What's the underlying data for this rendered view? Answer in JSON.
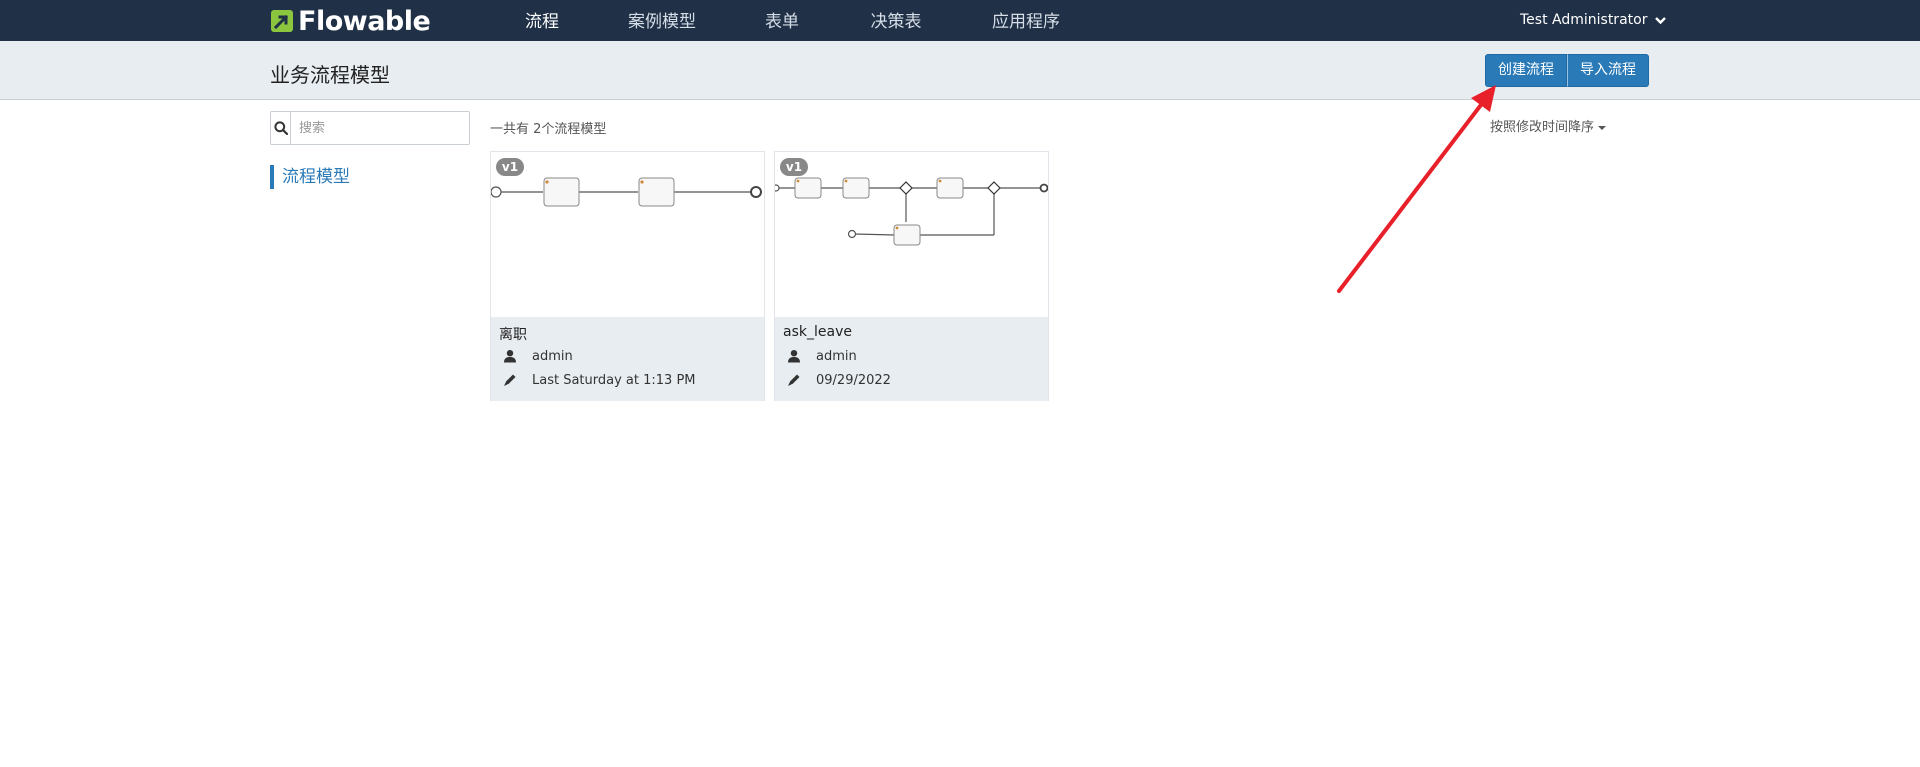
{
  "app": {
    "logo_text": "Flowable"
  },
  "nav": {
    "items": [
      {
        "label": "流程",
        "active": true
      },
      {
        "label": "案例模型",
        "active": false
      },
      {
        "label": "表单",
        "active": false
      },
      {
        "label": "决策表",
        "active": false
      },
      {
        "label": "应用程序",
        "active": false
      }
    ],
    "user_label": "Test Administrator"
  },
  "header": {
    "title": "业务流程模型",
    "create_button": "创建流程",
    "import_button": "导入流程"
  },
  "sidebar": {
    "search_placeholder": "搜索",
    "search_value": "",
    "items": [
      {
        "label": "流程模型",
        "active": true
      }
    ]
  },
  "main": {
    "count_text": "一共有 2个流程模型",
    "sort_label": "按照修改时间降序",
    "models": [
      {
        "version": "v1",
        "name": "离职",
        "owner": "admin",
        "modified": "Last Saturday at 1:13 PM"
      },
      {
        "version": "v1",
        "name": "ask_leave",
        "owner": "admin",
        "modified": "09/29/2022"
      }
    ]
  },
  "colors": {
    "navbar_bg": "#1f3047",
    "accent": "#2a7ab8",
    "logo_green": "#8cc63f",
    "annotation_red": "#e8202a"
  },
  "icons": {
    "search": "search-icon",
    "user": "user-icon",
    "edit": "pencil-icon",
    "user_menu": "chevron-down-icon"
  }
}
